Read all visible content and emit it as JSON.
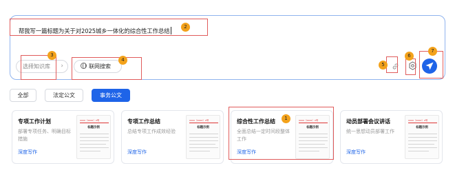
{
  "composer": {
    "prompt": "帮我写一篇标题为关于对2025城乡一体化的综合性工作总结",
    "knowledge_base": {
      "label": "选择知识库",
      "chevron": "›"
    },
    "web_search": {
      "label": "联网搜索",
      "icon": "globe-icon"
    },
    "link_icon": "link-icon",
    "settings_icon": "settings-icon",
    "send_icon": "send-icon",
    "accent": "#1e64e8"
  },
  "tabs": [
    {
      "label": "全部",
      "active": false
    },
    {
      "label": "法定公文",
      "active": false
    },
    {
      "label": "事务公文",
      "active": true
    }
  ],
  "cards": [
    {
      "title": "专项工作计划",
      "desc": "部署专项任务、明确目标措施",
      "link": "深度写作",
      "thumb_header": "xxxx〔xxxx〕x号",
      "thumb_title": "标题示例"
    },
    {
      "title": "专项工作总结",
      "desc": "总结专项工作成效经验",
      "link": "深度写作",
      "thumb_header": "xxxx〔xxxx〕x号",
      "thumb_title": "标题示例"
    },
    {
      "title": "综合性工作总结",
      "desc": "全面总结一定时间段整体工作",
      "link": "深度写作",
      "thumb_header": "xxxx〔xxxx〕x号",
      "thumb_title": "标题示例"
    },
    {
      "title": "动员部署会议讲话",
      "desc": "统一思想动员部署工作",
      "link": "深度写作",
      "thumb_header": "xxxx〔xxxx〕x号",
      "thumb_title": "标题示例"
    }
  ],
  "annotations": [
    "1",
    "2",
    "3",
    "4",
    "5",
    "6",
    "7"
  ],
  "annotation_colors": {
    "box": "#e05a5a",
    "badge": "#f3a21b"
  }
}
